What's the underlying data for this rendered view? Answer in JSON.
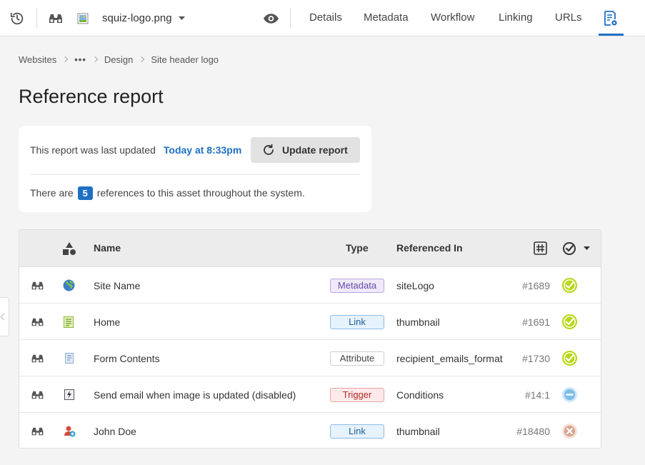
{
  "toolbar": {
    "asset_name": "squiz-logo.png",
    "tabs": [
      {
        "label": "Details"
      },
      {
        "label": "Metadata"
      },
      {
        "label": "Workflow"
      },
      {
        "label": "Linking"
      },
      {
        "label": "URLs"
      }
    ]
  },
  "breadcrumb": {
    "items": [
      "Websites",
      "•••",
      "Design",
      "Site header logo"
    ]
  },
  "page": {
    "title": "Reference report"
  },
  "summary": {
    "updated_prefix": "This report was last updated",
    "updated_time": "Today at 8:33pm",
    "update_button": "Update report",
    "count_prefix": "There are",
    "count": "5",
    "count_suffix": "references to this asset throughout the system."
  },
  "table": {
    "headers": {
      "name": "Name",
      "type": "Type",
      "referenced_in": "Referenced In"
    },
    "rows": [
      {
        "name": "Site Name",
        "type": "Metadata",
        "referenced_in": "siteLogo",
        "id": "#1689",
        "status": "live",
        "icon": "globe-icon"
      },
      {
        "name": "Home",
        "type": "Link",
        "referenced_in": "thumbnail",
        "id": "#1691",
        "status": "live",
        "icon": "page-icon"
      },
      {
        "name": "Form Contents",
        "type": "Attribute",
        "referenced_in": "recipient_emails_format",
        "id": "#1730",
        "status": "live",
        "icon": "form-icon"
      },
      {
        "name": "Send email when image is updated (disabled)",
        "type": "Trigger",
        "referenced_in": "Conditions",
        "id": "#14:1",
        "status": "disabled",
        "icon": "trigger-icon"
      },
      {
        "name": "John Doe",
        "type": "Link",
        "referenced_in": "thumbnail",
        "id": "#18480",
        "status": "archived",
        "icon": "user-icon"
      }
    ]
  },
  "colors": {
    "accent": "#1f6fc4",
    "status_live": "#b8d81a",
    "status_disabled": "#7fbde8",
    "status_archived": "#d9a590"
  }
}
